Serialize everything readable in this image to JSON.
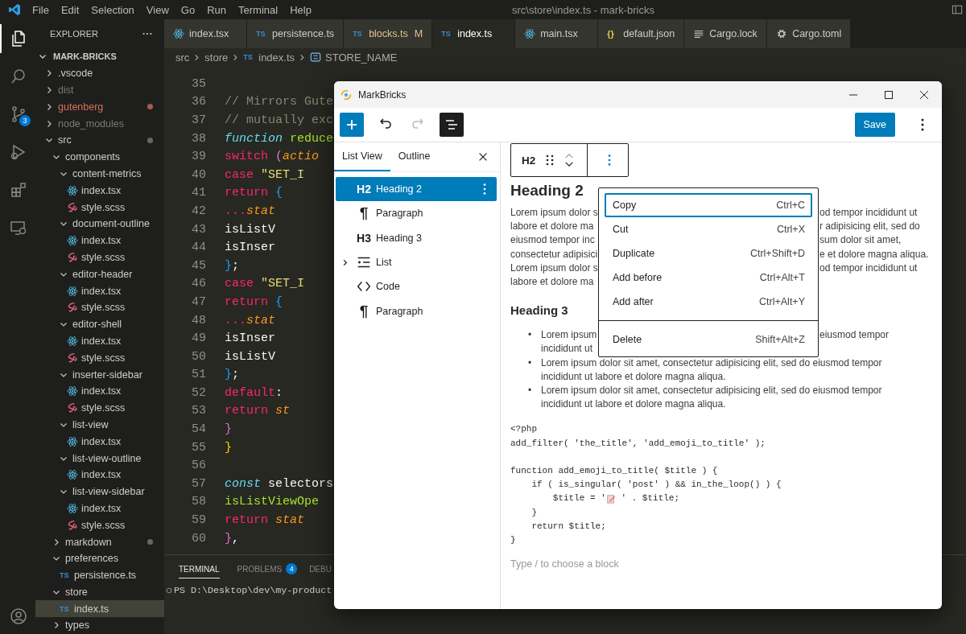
{
  "title_bar": {
    "menu": [
      "File",
      "Edit",
      "Selection",
      "View",
      "Go",
      "Run",
      "Terminal",
      "Help"
    ],
    "title": "src\\store\\index.ts - mark-bricks"
  },
  "activity_bar": [
    {
      "kind": "files",
      "selected": true
    },
    {
      "kind": "search",
      "selected": false
    },
    {
      "kind": "source-control",
      "selected": false,
      "badge": "3"
    },
    {
      "kind": "run",
      "selected": false
    },
    {
      "kind": "extensions",
      "selected": false
    },
    {
      "kind": "remote",
      "selected": false
    },
    {
      "kind": "account",
      "selected": false
    }
  ],
  "sidebar": {
    "title": "EXPLORER",
    "section": {
      "title": "MARK-BRICKS",
      "expanded": true
    },
    "tree": [
      {
        "name": ".vscode",
        "kind": "folder",
        "expanded": false,
        "selected": false,
        "dimmed": false,
        "error": false
      },
      {
        "name": "dist",
        "kind": "folder",
        "expanded": false,
        "selected": false,
        "dimmed": true,
        "error": false
      },
      {
        "name": "gutenberg",
        "kind": "folder",
        "expanded": false,
        "selected": false,
        "dimmed": false,
        "error": true,
        "color": "#a85a50"
      },
      {
        "name": "node_modules",
        "kind": "folder",
        "expanded": false,
        "selected": false,
        "dimmed": true,
        "error": false
      },
      {
        "name": "src",
        "kind": "folder",
        "expanded": true,
        "selected": false,
        "dimmed": false,
        "error": false,
        "color": "#6b665a",
        "children": [
          {
            "name": "components",
            "kind": "folder",
            "expanded": true,
            "selected": false,
            "children": [
              {
                "name": "content-metrics",
                "kind": "folder",
                "expanded": true,
                "selected": false,
                "children": [
                  {
                    "name": "index.tsx",
                    "kind": "tsx",
                    "selected": false
                  },
                  {
                    "name": "style.scss",
                    "kind": "scss",
                    "selected": false
                  }
                ]
              },
              {
                "name": "document-outline",
                "kind": "folder",
                "expanded": true,
                "selected": false,
                "children": [
                  {
                    "name": "index.tsx",
                    "kind": "tsx",
                    "selected": false
                  },
                  {
                    "name": "style.scss",
                    "kind": "scss",
                    "selected": false
                  }
                ]
              },
              {
                "name": "editor-header",
                "kind": "folder",
                "expanded": true,
                "selected": false,
                "children": [
                  {
                    "name": "index.tsx",
                    "kind": "tsx",
                    "selected": false
                  },
                  {
                    "name": "style.scss",
                    "kind": "scss",
                    "selected": false
                  }
                ]
              },
              {
                "name": "editor-shell",
                "kind": "folder",
                "expanded": true,
                "selected": false,
                "children": [
                  {
                    "name": "index.tsx",
                    "kind": "tsx",
                    "selected": false
                  },
                  {
                    "name": "style.scss",
                    "kind": "scss",
                    "selected": false
                  }
                ]
              },
              {
                "name": "inserter-sidebar",
                "kind": "folder",
                "expanded": true,
                "selected": false,
                "children": [
                  {
                    "name": "index.tsx",
                    "kind": "tsx",
                    "selected": false
                  },
                  {
                    "name": "style.scss",
                    "kind": "scss",
                    "selected": false
                  }
                ]
              },
              {
                "name": "list-view",
                "kind": "folder",
                "expanded": true,
                "selected": false,
                "children": [
                  {
                    "name": "index.tsx",
                    "kind": "tsx",
                    "selected": false
                  }
                ]
              },
              {
                "name": "list-view-outline",
                "kind": "folder",
                "expanded": true,
                "selected": false,
                "children": [
                  {
                    "name": "index.tsx",
                    "kind": "tsx",
                    "selected": false
                  }
                ]
              },
              {
                "name": "list-view-sidebar",
                "kind": "folder",
                "expanded": true,
                "selected": false,
                "children": [
                  {
                    "name": "index.tsx",
                    "kind": "tsx",
                    "selected": false
                  },
                  {
                    "name": "style.scss",
                    "kind": "scss",
                    "selected": false
                  }
                ]
              }
            ]
          },
          {
            "name": "markdown",
            "kind": "folder",
            "expanded": false,
            "selected": false,
            "color": "#6b665a"
          },
          {
            "name": "preferences",
            "kind": "folder",
            "expanded": true,
            "selected": false,
            "children": [
              {
                "name": "persistence.ts",
                "kind": "ts",
                "icon_text": "TS",
                "selected": false
              }
            ]
          },
          {
            "name": "store",
            "kind": "folder",
            "expanded": true,
            "selected": false,
            "children": [
              {
                "name": "index.ts",
                "kind": "ts",
                "icon_text": "TS",
                "selected": true
              }
            ]
          },
          {
            "name": "types",
            "kind": "folder",
            "expanded": false,
            "selected": false
          }
        ]
      }
    ]
  },
  "tabs": [
    {
      "label": "index.tsx",
      "kind": "react",
      "selected": false
    },
    {
      "label": "persistence.ts",
      "kind": "ts",
      "icon_text": "TS",
      "selected": false
    },
    {
      "label": "blocks.ts",
      "kind": "ts",
      "icon_text": "TS",
      "modified": "M",
      "selected": false
    },
    {
      "label": "index.ts",
      "kind": "ts",
      "icon_text": "TS",
      "selected": true
    },
    {
      "label": "main.tsx",
      "kind": "react",
      "selected": false
    },
    {
      "label": "default.json",
      "kind": "json",
      "icon_text": "{}",
      "selected": false
    },
    {
      "label": "Cargo.lock",
      "kind": "lines",
      "selected": false
    },
    {
      "label": "Cargo.toml",
      "kind": "gear",
      "selected": false
    }
  ],
  "breadcrumb": [
    {
      "text": "src",
      "kind": "folder"
    },
    {
      "text": "store",
      "kind": "folder"
    },
    {
      "text": "index.ts",
      "kind": "ts",
      "icon_text": "TS"
    },
    {
      "text": "STORE_NAME",
      "kind": "constant"
    }
  ],
  "code": [
    {
      "number": "35"
    },
    {
      "number": "36",
      "tokens": [
        {
          "text": "// Mirrors Gute",
          "kind": "comment"
        }
      ]
    },
    {
      "number": "37",
      "tokens": [
        {
          "text": "// mutually exc",
          "kind": "comment"
        }
      ]
    },
    {
      "number": "38",
      "tokens": [
        {
          "text": "function",
          "kind": "storage"
        },
        {
          "text": " reduce",
          "kind": "function"
        }
      ]
    },
    {
      "number": "39",
      "tokens": [
        {
          "text": "  switch",
          "kind": "keyword"
        },
        {
          "text": " (",
          "kind": "bracket2"
        },
        {
          "text": "actio",
          "kind": "param"
        }
      ]
    },
    {
      "number": "40",
      "tokens": [
        {
          "text": "    case",
          "kind": "keyword"
        },
        {
          "text": " \"SET_I",
          "kind": "string"
        }
      ]
    },
    {
      "number": "41",
      "tokens": [
        {
          "text": "      return",
          "kind": "keyword"
        },
        {
          "text": " {",
          "kind": "bracket3"
        }
      ]
    },
    {
      "number": "42",
      "tokens": [
        {
          "text": "        ...",
          "kind": "keyword"
        },
        {
          "text": "stat",
          "kind": "param"
        }
      ]
    },
    {
      "number": "43",
      "tokens": [
        {
          "text": "        isListV",
          "kind": "plain"
        }
      ]
    },
    {
      "number": "44",
      "tokens": [
        {
          "text": "        isInser",
          "kind": "plain"
        }
      ]
    },
    {
      "number": "45",
      "tokens": [
        {
          "text": "      }",
          "kind": "bracket3"
        },
        {
          "text": ";",
          "kind": "plain"
        }
      ]
    },
    {
      "number": "46",
      "tokens": [
        {
          "text": "    case",
          "kind": "keyword"
        },
        {
          "text": " \"SET_I",
          "kind": "string"
        }
      ]
    },
    {
      "number": "47",
      "tokens": [
        {
          "text": "      return",
          "kind": "keyword"
        },
        {
          "text": " {",
          "kind": "bracket3"
        }
      ]
    },
    {
      "number": "48",
      "tokens": [
        {
          "text": "        ...",
          "kind": "keyword"
        },
        {
          "text": "stat",
          "kind": "param"
        }
      ]
    },
    {
      "number": "49",
      "tokens": [
        {
          "text": "        isInser",
          "kind": "plain"
        }
      ]
    },
    {
      "number": "50",
      "tokens": [
        {
          "text": "        isListV",
          "kind": "plain"
        }
      ]
    },
    {
      "number": "51",
      "tokens": [
        {
          "text": "      }",
          "kind": "bracket3"
        },
        {
          "text": ";",
          "kind": "plain"
        }
      ]
    },
    {
      "number": "52",
      "tokens": [
        {
          "text": "    default",
          "kind": "keyword"
        },
        {
          "text": ":",
          "kind": "plain"
        }
      ]
    },
    {
      "number": "53",
      "tokens": [
        {
          "text": "      return",
          "kind": "keyword"
        },
        {
          "text": " st",
          "kind": "param"
        }
      ]
    },
    {
      "number": "54",
      "tokens": [
        {
          "text": "  }",
          "kind": "bracket2"
        }
      ]
    },
    {
      "number": "55",
      "tokens": [
        {
          "text": "}",
          "kind": "bracket1"
        }
      ]
    },
    {
      "number": "56"
    },
    {
      "number": "57",
      "tokens": [
        {
          "text": "const",
          "kind": "storage"
        },
        {
          "text": " selectors",
          "kind": "plain"
        }
      ]
    },
    {
      "number": "58",
      "tokens": [
        {
          "text": "  isListViewOpe",
          "kind": "function"
        }
      ]
    },
    {
      "number": "59",
      "tokens": [
        {
          "text": "    return",
          "kind": "keyword"
        },
        {
          "text": " stat",
          "kind": "param"
        }
      ]
    },
    {
      "number": "60",
      "tokens": [
        {
          "text": "  }",
          "kind": "bracket2"
        },
        {
          "text": ",",
          "kind": "plain"
        }
      ]
    }
  ],
  "panel": {
    "tabs": [
      {
        "label": "TERMINAL",
        "selected": true
      },
      {
        "label": "PROBLEMS",
        "badge": "4",
        "selected": false
      },
      {
        "label": "DEBU",
        "selected": false
      }
    ],
    "terminal_lines": [
      "PS D:\\Desktop\\dev\\my-product"
    ]
  },
  "app_window": {
    "title": "MarkBricks",
    "toolbar": {
      "list_view_on": true,
      "redo_disabled": true,
      "save": "Save"
    },
    "panel_tabs": [
      {
        "label": "List View",
        "selected": true
      },
      {
        "label": "Outline",
        "selected": false
      }
    ],
    "blocks": [
      {
        "kind": "heading",
        "icon_text": "H2",
        "label": "Heading 2",
        "selected": true
      },
      {
        "kind": "paragraph",
        "icon_text": "¶",
        "label": "Paragraph",
        "selected": false
      },
      {
        "kind": "heading",
        "icon_text": "H3",
        "label": "Heading 3",
        "selected": false
      },
      {
        "kind": "list",
        "label": "List",
        "expanded": false,
        "selected": false
      },
      {
        "kind": "code",
        "label": "Code",
        "selected": false
      },
      {
        "kind": "paragraph",
        "icon_text": "¶",
        "label": "Paragraph",
        "selected": false
      }
    ],
    "block_toolbar": {
      "label": "H2"
    },
    "content": [
      {
        "kind": "heading2",
        "text": "Heading 2"
      },
      {
        "kind": "paragraph",
        "lines": [
          {
            "left": "Lorem ipsum dolor s",
            "right": "od tempor incididunt ut"
          },
          {
            "left": "labore et dolore ma",
            "right": "r adipisicing elit, sed do"
          },
          {
            "left": "eiusmod tempor inc",
            "right": "sum dolor sit amet,"
          },
          {
            "left": "consectetur adipisici",
            "right": "e et dolore magna aliqua."
          },
          {
            "left": "Lorem ipsum dolor s",
            "right": "od tempor incididunt ut"
          },
          {
            "left": "labore et dolore ma"
          }
        ]
      },
      {
        "kind": "heading3",
        "text": "Heading 3"
      },
      {
        "kind": "list",
        "items": [
          {
            "marker": "•",
            "lines": [
              {
                "left": "Lorem ipsum",
                "right": "eiusmod tempor"
              },
              {
                "left": "incididunt ut"
              }
            ]
          },
          {
            "marker": "•",
            "text": "Lorem ipsum dolor sit amet, consectetur adipisicing elit, sed do eiusmod tempor incididunt ut labore et dolore magna aliqua."
          },
          {
            "marker": "•",
            "text": "Lorem ipsum dolor sit amet, consectetur adipisicing elit, sed do eiusmod tempor incididunt ut labore et dolore magna aliqua."
          }
        ]
      },
      {
        "kind": "code",
        "lines": [
          {
            "kind": "text",
            "text": "<?php"
          },
          {
            "kind": "text",
            "text": "add_filter( 'the_title', 'add_emoji_to_title' );"
          },
          {
            "kind": "blank"
          },
          {
            "kind": "text",
            "text": "function add_emoji_to_title( $title ) {"
          },
          {
            "kind": "text",
            "text": "    if ( is_singular( 'post' ) && in_the_loop() ) {"
          },
          {
            "kind": "emoji",
            "text": "        $title = '",
            "after": " ' . $title;"
          },
          {
            "kind": "text",
            "text": "    }"
          },
          {
            "kind": "text",
            "text": "    return $title;"
          },
          {
            "kind": "text",
            "text": "}"
          }
        ]
      },
      {
        "kind": "empty",
        "placeholder": "Type / to choose a block"
      }
    ],
    "context_menu": [
      {
        "label": "Copy",
        "shortcut": "Ctrl+C",
        "selected": true,
        "separator_before": false
      },
      {
        "label": "Cut",
        "shortcut": "Ctrl+X",
        "selected": false,
        "separator_before": false
      },
      {
        "label": "Duplicate",
        "shortcut": "Ctrl+Shift+D",
        "selected": false,
        "separator_before": false
      },
      {
        "label": "Add before",
        "shortcut": "Ctrl+Alt+T",
        "selected": false,
        "separator_before": false
      },
      {
        "label": "Add after",
        "shortcut": "Ctrl+Alt+Y",
        "selected": false,
        "separator_before": false
      },
      {
        "label": "Delete",
        "shortcut": "Shift+Alt+Z",
        "selected": false,
        "separator_before": true
      }
    ]
  }
}
